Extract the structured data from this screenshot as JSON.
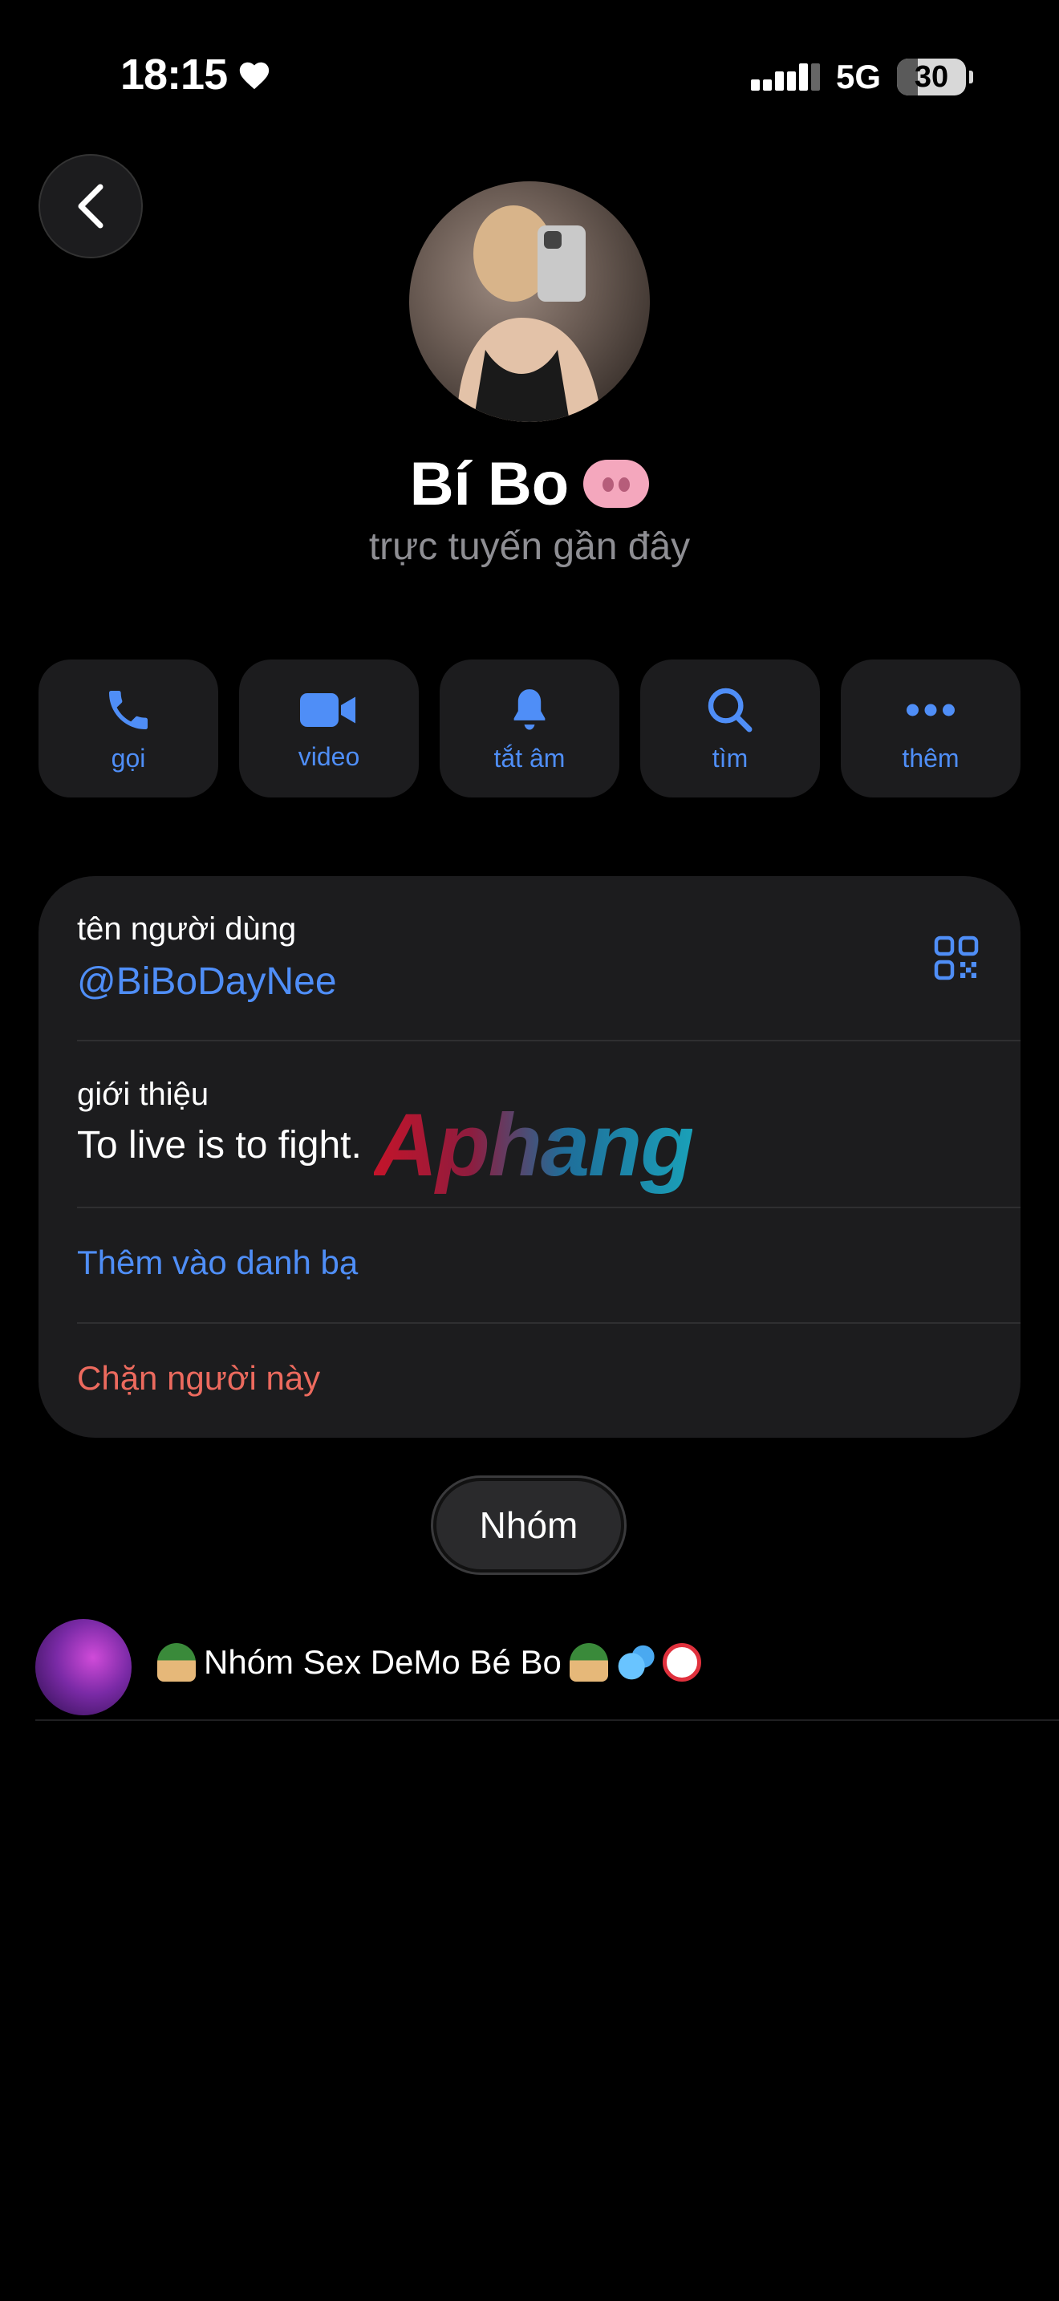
{
  "status_bar": {
    "time": "18:15",
    "network": "5G",
    "battery": "30",
    "battery_level": 0.3
  },
  "profile": {
    "name": "Bí Bo",
    "status": "trực tuyến gần đây"
  },
  "actions": [
    {
      "label": "gọi",
      "icon": "phone-icon"
    },
    {
      "label": "video",
      "icon": "video-camera-icon"
    },
    {
      "label": "tắt âm",
      "icon": "bell-icon"
    },
    {
      "label": "tìm",
      "icon": "search-icon"
    },
    {
      "label": "thêm",
      "icon": "more-dots-icon"
    }
  ],
  "info": {
    "username_label": "tên người dùng",
    "username": "@BiBoDayNee",
    "bio_label": "giới thiệu",
    "bio": "To live is to fight.",
    "add_contact": "Thêm vào danh bạ",
    "block": "Chặn người này",
    "watermark": "Aphang"
  },
  "groups": {
    "tab_label": "Nhóm",
    "items": [
      {
        "title": "Nhóm Sex DeMo Bé Bo"
      }
    ]
  },
  "colors": {
    "accent": "#4f8ef7",
    "danger": "#ec6a5e",
    "card": "#1c1c1e",
    "background": "#000000"
  }
}
